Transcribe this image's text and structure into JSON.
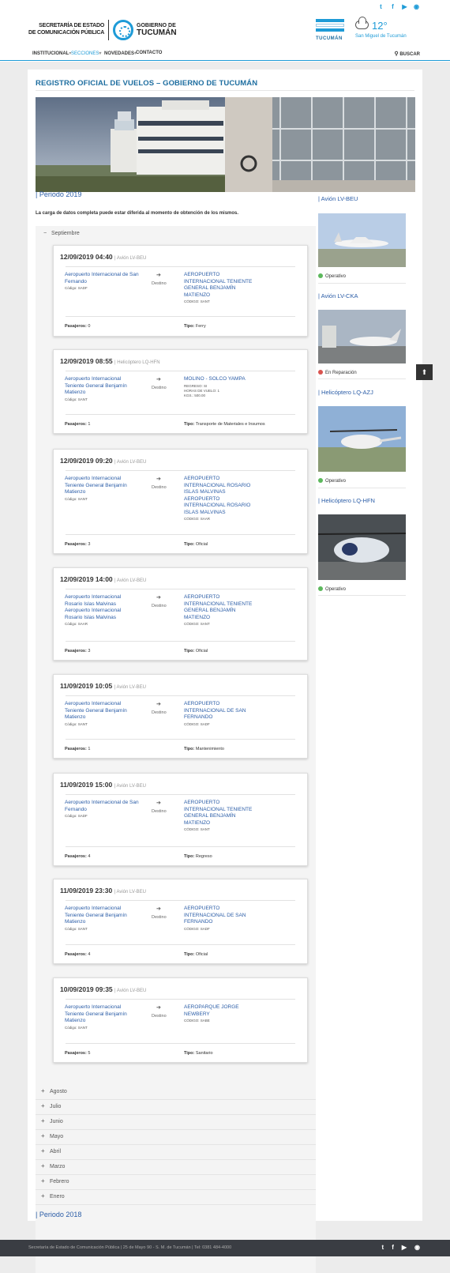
{
  "header": {
    "social": [
      "t",
      "f",
      "▶",
      "◉"
    ],
    "logo_left": [
      "SECRETARÍA DE ESTADO",
      "DE COMUNICACIÓN PÚBLICA"
    ],
    "logo_gov_top": "GOBIERNO DE",
    "logo_gov_bottom": "TUCUMÁN",
    "flag_text": "TUCUMÁN",
    "weather_temp": "12°",
    "weather_city": "San Miguel de Tucumán"
  },
  "nav": {
    "items": [
      "INSTITUCIONAL",
      "SECCIONES",
      "NOVEDADES",
      "CONTACTO"
    ],
    "search": "BUSCAR"
  },
  "page": {
    "title": "REGISTRO OFICIAL DE VUELOS – GOBIERNO DE TUCUMÁN",
    "period_2019": "| Periodo 2019",
    "note": "La carga de datos completa puede estar diferida al momento de obtención de los mismos.",
    "open_month": "Septiembre",
    "period_2018": "| Periodo 2018"
  },
  "labels": {
    "destino": "Destino",
    "pasajeros": "Pasajeros:",
    "tipo": "Tipo:"
  },
  "flights": [
    {
      "date": "12/09/2019 04:40",
      "aircraft": "| Avión LV-BEU",
      "origin": "Aeropuerto Internacional de San Fernando",
      "origin_code": "Código: SADF",
      "dest": "AEROPUERTO INTERNACIONAL TENIENTE GENERAL BENJAMÍN MATIENZO",
      "dest_code": "CÓDIGO: SANT",
      "pax": "0",
      "tipo": "Ferry"
    },
    {
      "date": "12/09/2019 08:55",
      "aircraft": "| Helicóptero LQ-HFN",
      "origin": "Aeropuerto Internacional Teniente General Benjamín Matienzo",
      "origin_code": "Código: SANT",
      "dest": "MOLINO - SOLCO YAMPA",
      "dest_code": "REGRESO: SI\nHORAS DE VUELO: 1\nKGS.: 500.00",
      "pax": "1",
      "tipo": "Transporte de Materiales e Insumos"
    },
    {
      "date": "12/09/2019 09:20",
      "aircraft": "| Avión LV-BEU",
      "origin": "Aeropuerto Internacional Teniente General Benjamín Matienzo",
      "origin_code": "Código: SANT",
      "dest": "AEROPUERTO INTERNACIONAL ROSARIO ISLAS MALVINAS AEROPUERTO INTERNACIONAL ROSARIO ISLAS MALVINAS",
      "dest_code": "CÓDIGO: SAAR",
      "pax": "3",
      "tipo": "Oficial"
    },
    {
      "date": "12/09/2019 14:00",
      "aircraft": "| Avión LV-BEU",
      "origin": "Aeropuerto Internacional Rosario Islas Malvinas Aeropuerto Internacional Rosario Islas Malvinas",
      "origin_code": "Código: SAAR",
      "dest": "AEROPUERTO INTERNACIONAL TENIENTE GENERAL BENJAMÍN MATIENZO",
      "dest_code": "CÓDIGO: SANT",
      "pax": "3",
      "tipo": "Oficial"
    },
    {
      "date": "11/09/2019 10:05",
      "aircraft": "| Avión LV-BEU",
      "origin": "Aeropuerto Internacional Teniente General Benjamín Matienzo",
      "origin_code": "Código: SANT",
      "dest": "AEROPUERTO INTERNACIONAL DE SAN FERNANDO",
      "dest_code": "CÓDIGO: SADF",
      "pax": "1",
      "tipo": "Mantenimiento"
    },
    {
      "date": "11/09/2019 15:00",
      "aircraft": "| Avión LV-BEU",
      "origin": "Aeropuerto Internacional de San Fernando",
      "origin_code": "Código: SADF",
      "dest": "AEROPUERTO INTERNACIONAL TENIENTE GENERAL BENJAMÍN MATIENZO",
      "dest_code": "CÓDIGO: SANT",
      "pax": "4",
      "tipo": "Regreso"
    },
    {
      "date": "11/09/2019 23:30",
      "aircraft": "| Avión LV-BEU",
      "origin": "Aeropuerto Internacional Teniente General Benjamín Matienzo",
      "origin_code": "Código: SANT",
      "dest": "AEROPUERTO INTERNACIONAL DE SAN FERNANDO",
      "dest_code": "CÓDIGO: SADF",
      "pax": "4",
      "tipo": "Oficial"
    },
    {
      "date": "10/09/2019 09:35",
      "aircraft": "| Avión LV-BEU",
      "origin": "Aeropuerto Internacional Teniente General Benjamín Matienzo",
      "origin_code": "Código: SANT",
      "dest": "AEROPARQUE JORGE NEWBERY",
      "dest_code": "CÓDIGO: SABE",
      "pax": "5",
      "tipo": "Sanitario"
    }
  ],
  "months_closed": [
    "Agosto",
    "Julio",
    "Junio",
    "Mayo",
    "Abril",
    "Marzo",
    "Febrero",
    "Enero"
  ],
  "sidebar": [
    {
      "title": "| Avión LV-BEU",
      "status": "Operativo",
      "status_color": "#5cb85c"
    },
    {
      "title": "| Avión LV-CKA",
      "status": "En Reparación",
      "status_color": "#d9534f"
    },
    {
      "title": "| Helicóptero LQ-AZJ",
      "status": "Operativo",
      "status_color": "#5cb85c"
    },
    {
      "title": "| Helicóptero LQ-HFN",
      "status": "Operativo",
      "status_color": "#5cb85c"
    }
  ],
  "footer": {
    "text": "Secretaría de Estado de Comunicación Pública | 25 de Mayo 90 - S. M. de Tucumán | Tel: 0381 484-4000",
    "social": [
      "t",
      "f",
      "▶",
      "◉"
    ]
  }
}
